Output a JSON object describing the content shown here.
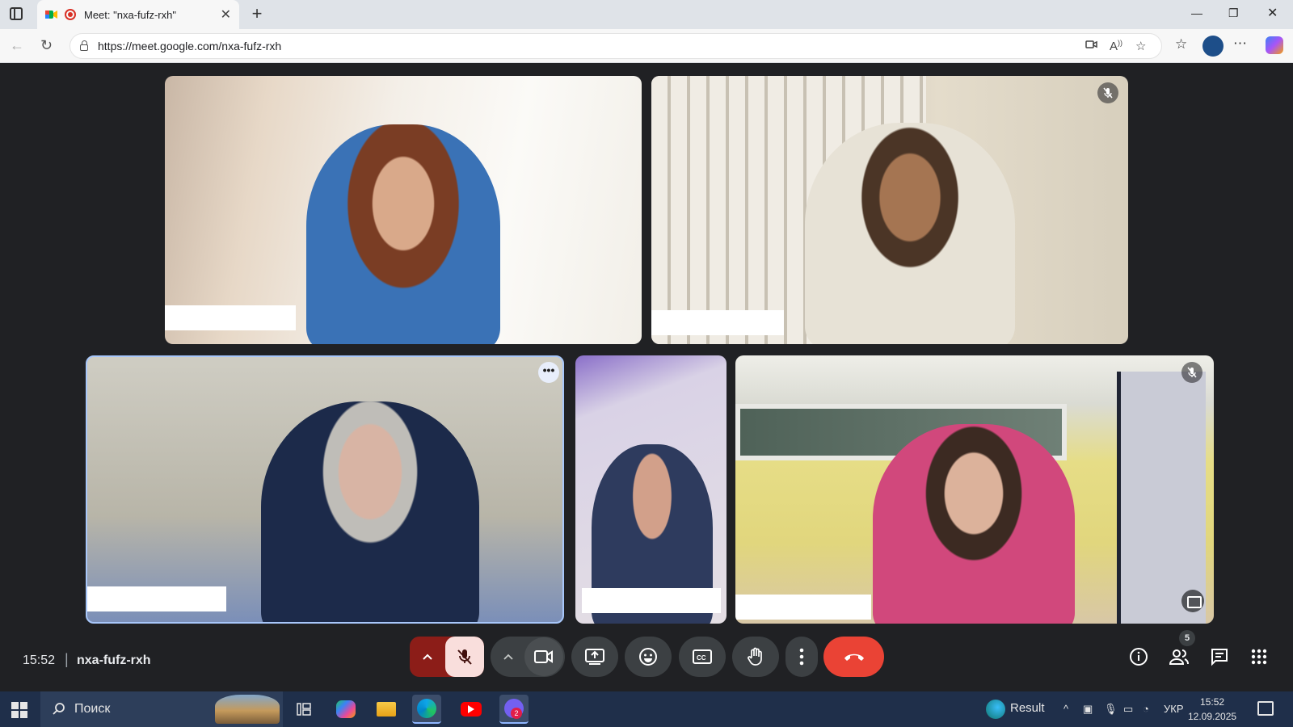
{
  "browser": {
    "tab_title": "Meet: \"nxa-fufz-rxh\"",
    "url": "https://meet.google.com/nxa-fufz-rxh"
  },
  "meeting": {
    "time": "15:52",
    "code": "nxa-fufz-rxh",
    "participant_count": "5"
  },
  "participants": [
    {
      "tile": 1,
      "muted": false
    },
    {
      "tile": 2,
      "muted": true
    },
    {
      "tile": 3,
      "muted": false,
      "highlighted": true
    },
    {
      "tile": 4,
      "muted": false
    },
    {
      "tile": 5,
      "muted": true
    }
  ],
  "controls": {
    "icons": [
      "chevron-up-icon",
      "mic-off-icon",
      "chevron-up-icon",
      "camera-icon",
      "present-icon",
      "emoji-icon",
      "captions-icon",
      "raise-hand-icon",
      "more-vert-icon",
      "end-call-icon"
    ],
    "right_icons": [
      "info-icon",
      "people-icon",
      "chat-icon",
      "apps-icon"
    ],
    "mic_accent": "#8c1d18",
    "end_call_color": "#ea4335"
  },
  "taskbar": {
    "search_label": "Поиск",
    "weather_label": "Result",
    "language": "УКР",
    "clock_time": "15:52",
    "clock_date": "12.09.2025",
    "viber_badge": "2"
  }
}
